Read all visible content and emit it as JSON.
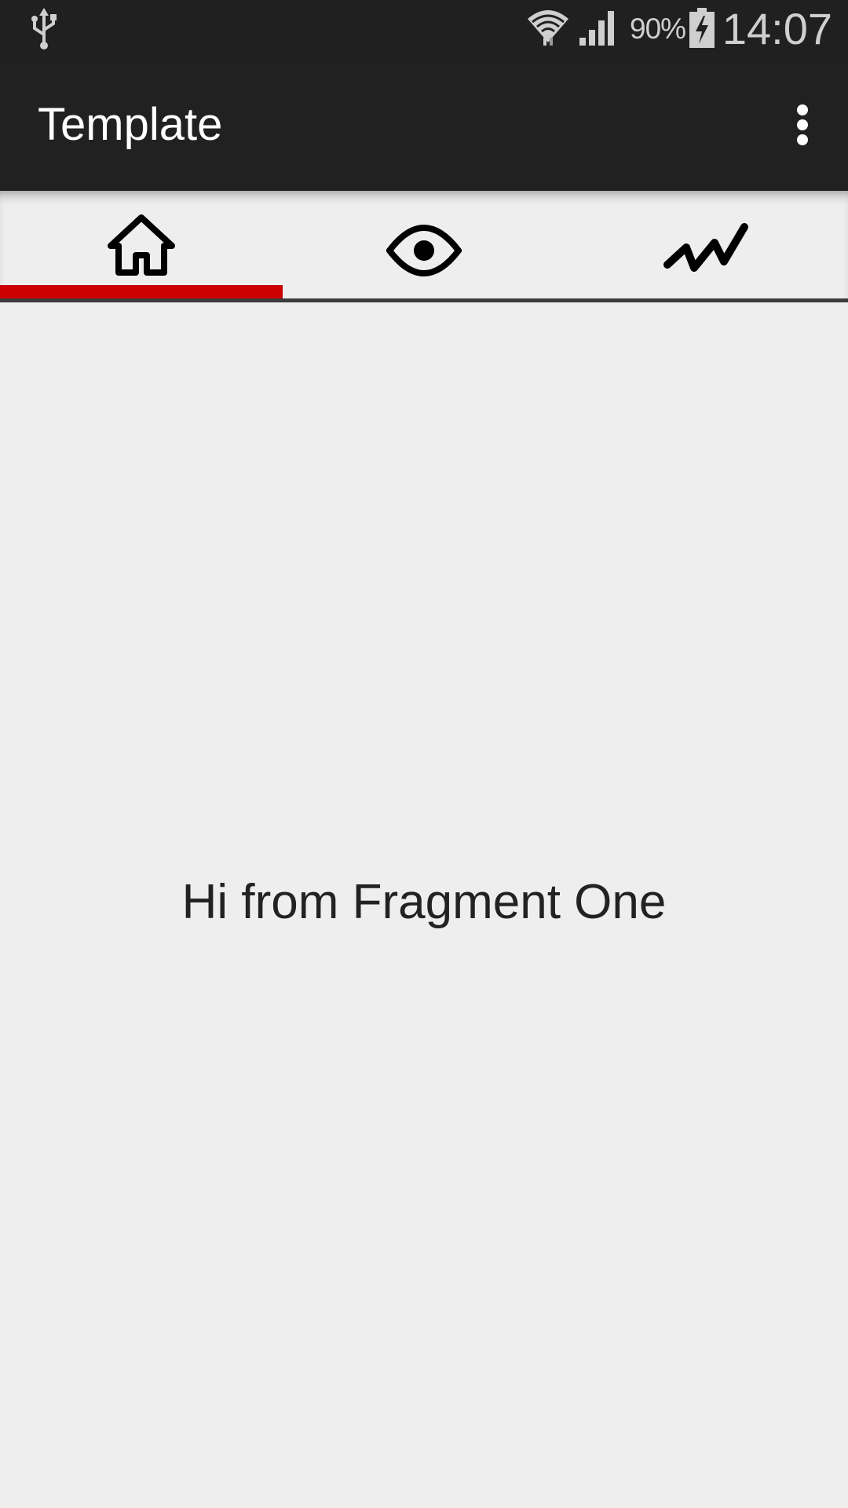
{
  "status_bar": {
    "battery_percent": "90%",
    "time": "14:07",
    "icons": [
      "usb-icon",
      "wifi-icon",
      "signal-icon",
      "battery-charging-icon"
    ]
  },
  "app_bar": {
    "title": "Template",
    "overflow_icon": "more-vert-icon"
  },
  "tabs": [
    {
      "icon": "home-icon",
      "selected": true
    },
    {
      "icon": "eye-icon",
      "selected": false
    },
    {
      "icon": "trending-icon",
      "selected": false
    }
  ],
  "colors": {
    "tab_indicator": "#cc0000",
    "app_bar": "#212121",
    "status_bar": "#202020",
    "background": "#eeeeee"
  },
  "content": {
    "message": "Hi from Fragment One"
  }
}
